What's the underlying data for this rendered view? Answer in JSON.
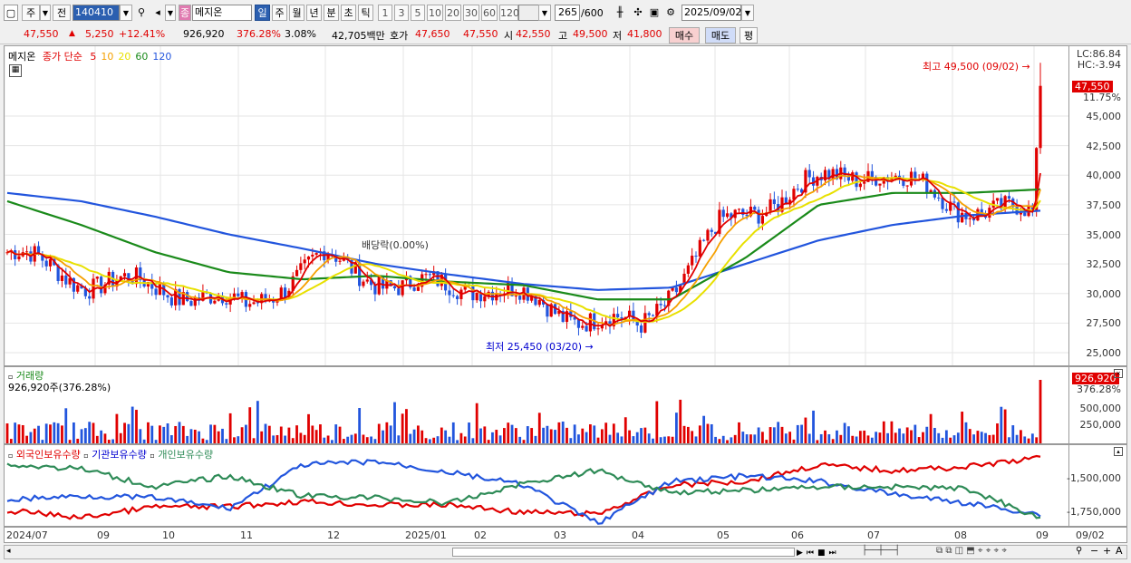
{
  "toolbar": {
    "period_label": "주",
    "prev_label": "전",
    "code_value": "140410",
    "stock_name": "메지온",
    "periods": [
      "일",
      "주",
      "월",
      "년",
      "분",
      "초",
      "틱"
    ],
    "active_period": "일",
    "intervals": [
      "1",
      "3",
      "5",
      "10",
      "20",
      "30",
      "60",
      "120"
    ],
    "count_value": "265",
    "count_max": "/600",
    "date_value": "2025/09/02"
  },
  "info": {
    "price": "47,550",
    "change": "5,250",
    "change_pct": "+12.41%",
    "volume": "926,920",
    "volume_ratio": "376.28%",
    "turnover_pct": "3.08%",
    "amount": "42,705백만",
    "quote_label": "호가",
    "bid": "47,650",
    "ask": "47,550",
    "open_label": "시",
    "open": "42,550",
    "high_label": "고",
    "high": "49,500",
    "low_label": "저",
    "low": "41,800",
    "buy_label": "매수",
    "sell_label": "매도",
    "eval_label": "평"
  },
  "legend": {
    "name": "메지온",
    "ma_title": "종가 단순",
    "ma_periods": [
      "5",
      "10",
      "20",
      "60",
      "120"
    ],
    "ma_colors": [
      "#e00000",
      "#f5a000",
      "#e8e000",
      "#1a8a1a",
      "#2255dd"
    ]
  },
  "axis_right": {
    "lc": "LC:86.84",
    "hc": "HC:-3.94",
    "price_tag": "47,550",
    "pct_tag": "11.75%",
    "price_ticks": [
      "45,000",
      "42,500",
      "40,000",
      "37,500",
      "35,000",
      "32,500",
      "30,000",
      "27,500",
      "25,000"
    ],
    "vol_tag": "926,920",
    "vol_pct_tag": "376.28%",
    "vol_ticks": [
      "500,000",
      "250,000"
    ],
    "hold_ticks": [
      "-1,500,000",
      "-1,750,000"
    ]
  },
  "annotations": {
    "high": "최고 49,500 (09/02)",
    "low": "최저 25,450 (03/20)",
    "dividend": "배당락(0.00%)"
  },
  "volume_panel": {
    "title": "거래량",
    "value": "926,920주(376.28%)"
  },
  "holdings_panel": {
    "series": [
      "외국인보유수량",
      "기관보유수량",
      "개인보유수량"
    ],
    "colors": [
      "#e00000",
      "#2255dd",
      "#2e8b57"
    ]
  },
  "x_labels": [
    "2024/07",
    "09",
    "10",
    "11",
    "12",
    "2025/01",
    "02",
    "03",
    "04",
    "05",
    "06",
    "07",
    "08",
    "09"
  ],
  "x_tail": "09/02",
  "scroll_icons": [
    "▶",
    "⏮",
    "■",
    "⏭"
  ],
  "chart_data": {
    "type": "candlestick",
    "title": "메지온",
    "price_axis": {
      "min": 25000,
      "max": 45000,
      "ticks": [
        25000,
        27500,
        30000,
        32500,
        35000,
        37500,
        40000,
        42500,
        45000
      ]
    },
    "last": {
      "date": "2025/09/02",
      "open": 42550,
      "high": 49500,
      "low": 41800,
      "close": 47550,
      "volume": 926920
    },
    "period_high": {
      "value": 49500,
      "date": "09/02"
    },
    "period_low": {
      "value": 25450,
      "date": "03/20"
    },
    "monthly_close_approx": [
      {
        "month": "2024/07",
        "close": 33500
      },
      {
        "month": "2024/08",
        "close": 31000
      },
      {
        "month": "2024/09",
        "close": 30500
      },
      {
        "month": "2024/10",
        "close": 28800
      },
      {
        "month": "2024/11",
        "close": 33000
      },
      {
        "month": "2024/12",
        "close": 30500
      },
      {
        "month": "2025/01",
        "close": 30800
      },
      {
        "month": "2025/02",
        "close": 28500
      },
      {
        "month": "2025/03",
        "close": 27000
      },
      {
        "month": "2025/04",
        "close": 35500
      },
      {
        "month": "2025/05",
        "close": 39000
      },
      {
        "month": "2025/06",
        "close": 40500
      },
      {
        "month": "2025/07",
        "close": 37500
      },
      {
        "month": "2025/08",
        "close": 36500
      },
      {
        "month": "2025/09",
        "close": 47550
      }
    ],
    "ma120_approx": [
      38500,
      37800,
      36500,
      35000,
      33800,
      32500,
      31600,
      30800,
      30300,
      30500,
      32500,
      34500,
      35800,
      36600,
      37000
    ],
    "ma60_approx": [
      37800,
      35800,
      33500,
      31800,
      31200,
      31500,
      31000,
      30700,
      29500,
      29500,
      33000,
      37500,
      38500,
      38500,
      38800
    ],
    "volume_axis": {
      "ticks": [
        250000,
        500000
      ]
    },
    "holdings_axis": {
      "ticks": [
        -1500000,
        -1750000
      ]
    }
  }
}
